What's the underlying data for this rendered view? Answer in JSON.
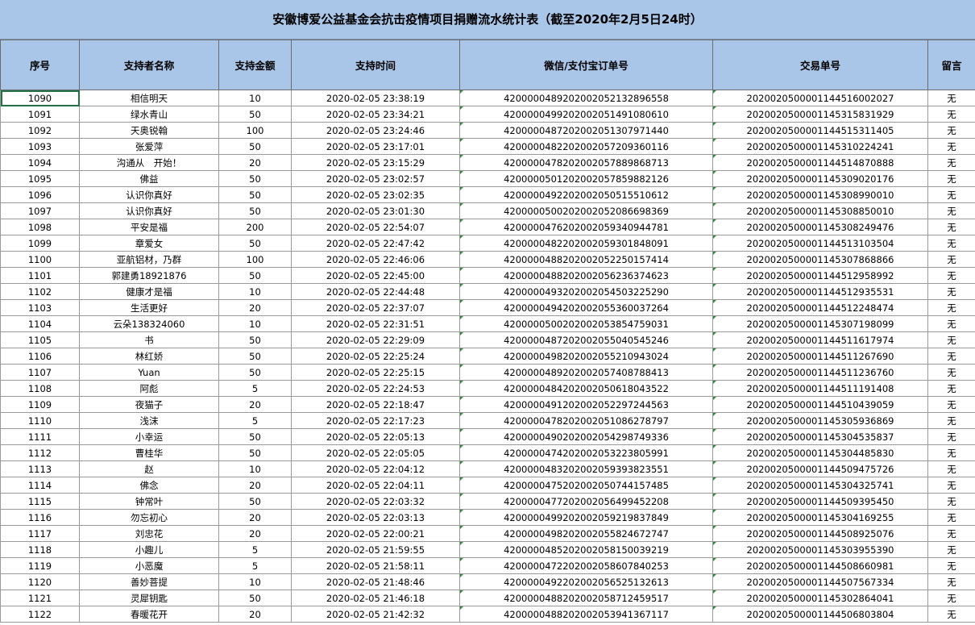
{
  "title": "安徽博爱公益基金会抗击疫情项目捐赠流水统计表（截至2020年2月5日24时）",
  "columns": [
    "序号",
    "支持者名称",
    "支持金额",
    "支持时间",
    "微信/支付宝订单号",
    "交易单号",
    "留言"
  ],
  "rows": [
    [
      "1090",
      "相信明天",
      "10",
      "2020-02-05 23:38:19",
      "4200000489202002052132896558",
      "2020020500001144516002027",
      "无"
    ],
    [
      "1091",
      "绿水青山",
      "50",
      "2020-02-05 23:34:21",
      "4200000499202002051491080610",
      "2020020500001145315831929",
      "无"
    ],
    [
      "1092",
      "天奥锐翰",
      "100",
      "2020-02-05 23:24:46",
      "4200000487202002051307971440",
      "2020020500001144515311405",
      "无"
    ],
    [
      "1093",
      "张爱萍",
      "50",
      "2020-02-05 23:17:01",
      "4200000482202002057209360116",
      "2020020500001145310224241",
      "无"
    ],
    [
      "1094",
      "沟通从　开始！",
      "20",
      "2020-02-05 23:15:29",
      "4200000478202002057889868713",
      "2020020500001144514870888",
      "无"
    ],
    [
      "1095",
      "佛益",
      "50",
      "2020-02-05 23:02:57",
      "4200000501202002057859882126",
      "2020020500001145309020176",
      "无"
    ],
    [
      "1096",
      "认识你真好",
      "50",
      "2020-02-05 23:02:35",
      "4200000492202002050515510612",
      "2020020500001145308990010",
      "无"
    ],
    [
      "1097",
      "认识你真好",
      "50",
      "2020-02-05 23:01:30",
      "4200000500202002052086698369",
      "2020020500001145308850010",
      "无"
    ],
    [
      "1098",
      "平安是福",
      "200",
      "2020-02-05 22:54:07",
      "4200000476202002059340944781",
      "2020020500001145308249476",
      "无"
    ],
    [
      "1099",
      "章爱女",
      "50",
      "2020-02-05 22:47:42",
      "4200000482202002059301848091",
      "2020020500001144513103504",
      "无"
    ],
    [
      "1100",
      "亚航铝材，乃群",
      "100",
      "2020-02-05 22:46:06",
      "4200000488202002052250157414",
      "2020020500001145307868866",
      "无"
    ],
    [
      "1101",
      "郭建勇18921876",
      "50",
      "2020-02-05 22:45:00",
      "4200000488202002056236374623",
      "2020020500001144512958992",
      "无"
    ],
    [
      "1102",
      "健康才是福",
      "10",
      "2020-02-05 22:44:48",
      "4200000493202002054503225290",
      "2020020500001144512935531",
      "无"
    ],
    [
      "1103",
      "生活更好",
      "20",
      "2020-02-05 22:37:07",
      "4200000494202002055360037264",
      "2020020500001144512248474",
      "无"
    ],
    [
      "1104",
      "云朵138324060",
      "10",
      "2020-02-05 22:31:51",
      "4200000500202002053854759031",
      "2020020500001145307198099",
      "无"
    ],
    [
      "1105",
      "书",
      "50",
      "2020-02-05 22:29:09",
      "4200000487202002055040545246",
      "2020020500001144511617974",
      "无"
    ],
    [
      "1106",
      "林红娇",
      "50",
      "2020-02-05 22:25:24",
      "4200000498202002055210943024",
      "2020020500001144511267690",
      "无"
    ],
    [
      "1107",
      "Yuan",
      "50",
      "2020-02-05 22:25:15",
      "4200000489202002057408788413",
      "2020020500001144511236760",
      "无"
    ],
    [
      "1108",
      "阿彪",
      "5",
      "2020-02-05 22:24:53",
      "4200000484202002050618043522",
      "2020020500001144511191408",
      "无"
    ],
    [
      "1109",
      "夜猫子",
      "20",
      "2020-02-05 22:18:47",
      "4200000491202002052297244563",
      "2020020500001144510439059",
      "无"
    ],
    [
      "1110",
      "浅沫",
      "5",
      "2020-02-05 22:17:23",
      "4200000478202002051086278797",
      "2020020500001145305936869",
      "无"
    ],
    [
      "1111",
      "小幸运",
      "50",
      "2020-02-05 22:05:13",
      "4200000490202002054298749336",
      "2020020500001145304535837",
      "无"
    ],
    [
      "1112",
      "曹桂华",
      "50",
      "2020-02-05 22:05:05",
      "4200000474202002053223805991",
      "2020020500001145304485830",
      "无"
    ],
    [
      "1113",
      "赵",
      "10",
      "2020-02-05 22:04:12",
      "4200000483202002059393823551",
      "2020020500001144509475726",
      "无"
    ],
    [
      "1114",
      "佛念",
      "20",
      "2020-02-05 22:04:11",
      "4200000475202002050744157485",
      "2020020500001145304325741",
      "无"
    ],
    [
      "1115",
      "钟常叶",
      "50",
      "2020-02-05 22:03:32",
      "4200000477202002056499452208",
      "2020020500001144509395450",
      "无"
    ],
    [
      "1116",
      "勿忘初心",
      "20",
      "2020-02-05 22:03:13",
      "4200000499202002059219837849",
      "2020020500001145304169255",
      "无"
    ],
    [
      "1117",
      "刘忠花",
      "20",
      "2020-02-05 22:00:21",
      "4200000498202002055824672747",
      "2020020500001144508925076",
      "无"
    ],
    [
      "1118",
      "小趣儿",
      "5",
      "2020-02-05 21:59:55",
      "4200000485202002058150039219",
      "2020020500001145303955390",
      "无"
    ],
    [
      "1119",
      "小恶魔",
      "5",
      "2020-02-05 21:58:11",
      "4200000472202002058607840253",
      "2020020500001144508660981",
      "无"
    ],
    [
      "1120",
      "善妙菩提",
      "10",
      "2020-02-05 21:48:46",
      "4200000492202002056525132613",
      "2020020500001144507567334",
      "无"
    ],
    [
      "1121",
      "灵犀钥匙",
      "50",
      "2020-02-05 21:46:18",
      "4200000488202002058712459517",
      "2020020500001145302864041",
      "无"
    ],
    [
      "1122",
      "春暖花开",
      "20",
      "2020-02-05 21:42:32",
      "4200000488202002053941367117",
      "2020020500001144506803804",
      "无"
    ]
  ]
}
